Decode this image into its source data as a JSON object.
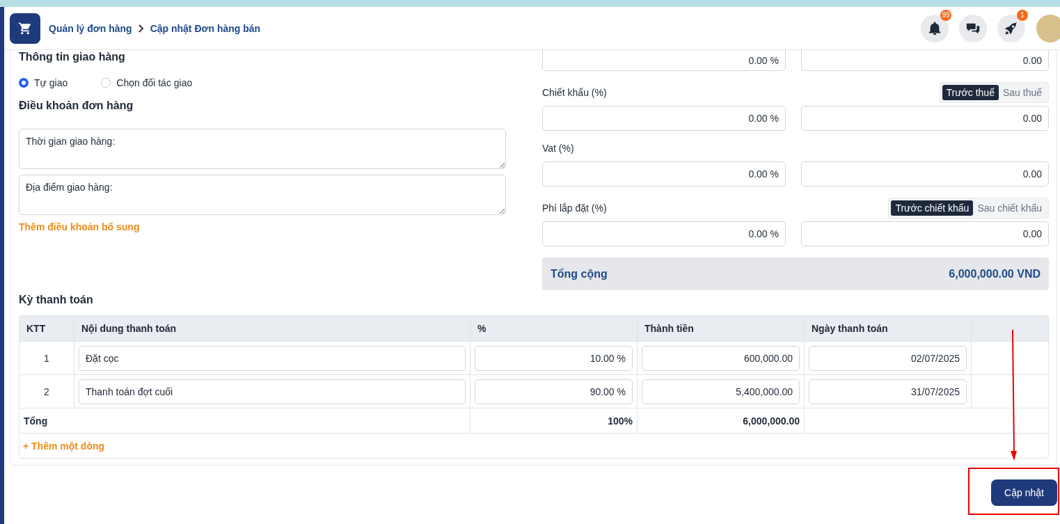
{
  "header": {
    "breadcrumb": [
      "Quản lý đơn hàng",
      "Cập nhật Đơn hàng bán"
    ],
    "notification_badge": "99",
    "launch_badge": "1"
  },
  "delivery": {
    "title": "Thông tin giao hàng",
    "options": [
      {
        "label": "Tự giao",
        "selected": true
      },
      {
        "label": "Chọn đối tác giao",
        "selected": false
      }
    ]
  },
  "terms": {
    "title": "Điều khoản đơn hàng",
    "fields": [
      "Thời gian giao hàng:",
      "Địa điểm giao hàng:"
    ],
    "add_link": "Thêm điều khoản bổ sung"
  },
  "adjustments": [
    {
      "percent": "0.00 %",
      "amount": "0.00"
    },
    {
      "label": "Chiết khấu (%)",
      "toggle": [
        {
          "label": "Trước thuế",
          "selected": true
        },
        {
          "label": "Sau thuế",
          "selected": false
        }
      ],
      "percent": "0.00 %",
      "amount": "0.00"
    },
    {
      "label": "Vat (%)",
      "percent": "0.00 %",
      "amount": "0.00"
    },
    {
      "label": "Phí lắp đặt (%)",
      "toggle": [
        {
          "label": "Trước chiết khấu",
          "selected": true
        },
        {
          "label": "Sau chiết khấu",
          "selected": false
        }
      ],
      "percent": "0.00 %",
      "amount": "0.00"
    }
  ],
  "total": {
    "label": "Tổng cộng",
    "value": "6,000,000.00 VND"
  },
  "payments": {
    "title": "Kỳ thanh toán",
    "columns": [
      "KTT",
      "Nội dung thanh toán",
      "%",
      "Thành tiền",
      "Ngày thanh toán"
    ],
    "rows": [
      {
        "no": "1",
        "content": "Đặt cọc",
        "percent": "10.00 %",
        "amount": "600,000.00",
        "date": "02/07/2025"
      },
      {
        "no": "2",
        "content": "Thanh toán đợt cuối",
        "percent": "90.00 %",
        "amount": "5,400,000.00",
        "date": "31/07/2025"
      }
    ],
    "total_label": "Tổng",
    "total_percent": "100%",
    "total_amount": "6,000,000.00",
    "add_row": "+ Thêm một dòng"
  },
  "submit_button": "Cập nhật"
}
